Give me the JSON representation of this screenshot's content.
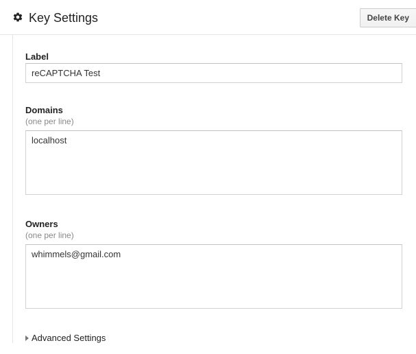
{
  "header": {
    "title": "Key Settings",
    "delete_label": "Delete Key"
  },
  "fields": {
    "label": {
      "title": "Label",
      "value": "reCAPTCHA Test"
    },
    "domains": {
      "title": "Domains",
      "hint": "(one per line)",
      "value": "localhost"
    },
    "owners": {
      "title": "Owners",
      "hint": "(one per line)",
      "value": "whimmels@gmail.com"
    }
  },
  "advanced": {
    "label": "Advanced Settings"
  }
}
